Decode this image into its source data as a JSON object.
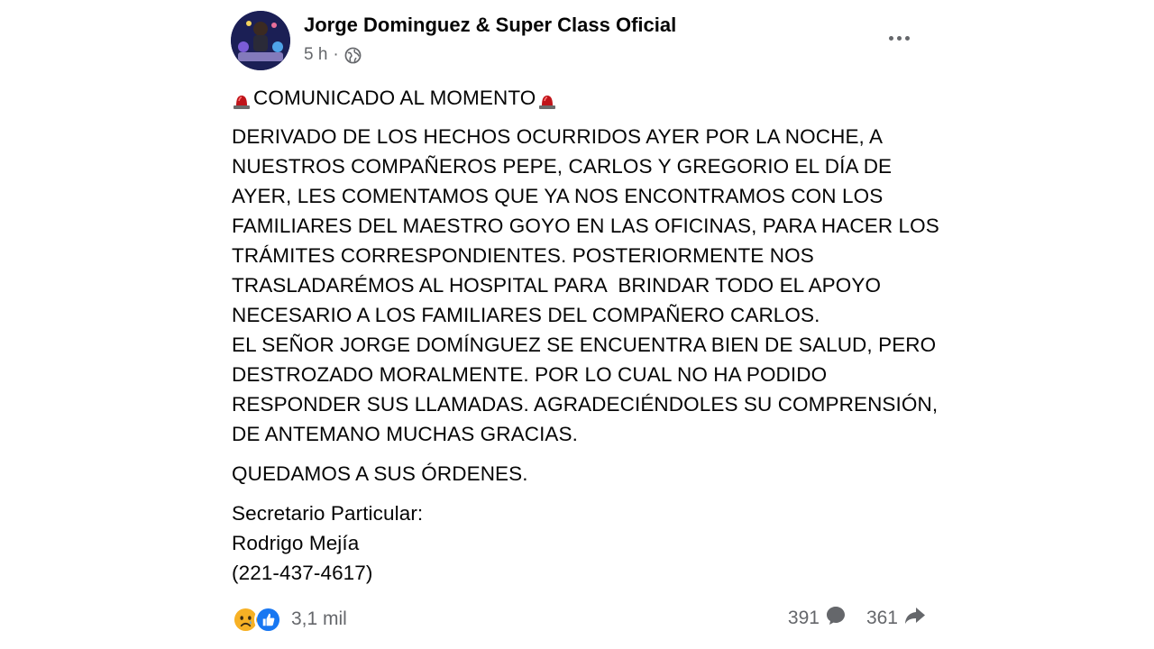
{
  "post": {
    "author": "Jorge Dominguez & Super Class Oficial",
    "time": "5 h",
    "separator": "·",
    "privacy_icon": "globe-icon",
    "menu_icon": "more-options-icon",
    "headline": "COMUNICADO AL MOMENTO",
    "headline_icon": "police-light-emoji",
    "body_lines": [
      "DERIVADO DE LOS HECHOS OCURRIDOS AYER POR LA NOCHE, A",
      "NUESTROS COMPAÑEROS PEPE, CARLOS Y GREGORIO EL DÍA DE",
      "AYER, LES COMENTAMOS QUE YA NOS ENCONTRAMOS CON LOS",
      "FAMILIARES DEL MAESTRO GOYO EN LAS OFICINAS, PARA HACER LOS",
      "TRÁMITES CORRESPONDIENTES. POSTERIORMENTE NOS",
      "TRASLADARÉMOS AL HOSPITAL PARA  BRINDAR TODO EL APOYO",
      "NECESARIO A LOS FAMILIARES DEL COMPAÑERO CARLOS.",
      "EL SEÑOR JORGE DOMÍNGUEZ SE ENCUENTRA BIEN DE SALUD, PERO",
      "DESTROZADO MORALMENTE. POR LO CUAL NO HA PODIDO",
      "RESPONDER SUS LLAMADAS. AGRADECIÉNDOLES SU COMPRENSIÓN,",
      "DE ANTEMANO MUCHAS GRACIAS."
    ],
    "closing": "QUEDAMOS A SUS ÓRDENES.",
    "signature_lines": [
      "Secretario Particular:",
      "Rodrigo Mejía",
      "(221-437-4617)"
    ]
  },
  "footer": {
    "reaction_icons": [
      "sad-reaction-icon",
      "like-reaction-icon"
    ],
    "reaction_count": "3,1 mil",
    "comments_count": "391",
    "comments_icon": "comment-icon",
    "shares_count": "361",
    "shares_icon": "share-icon"
  },
  "colors": {
    "text": "#050505",
    "secondary_text": "#65676b",
    "like_blue": "#1877f2",
    "sad_yellow": "#f7b125",
    "siren_red": "#c0141a"
  }
}
